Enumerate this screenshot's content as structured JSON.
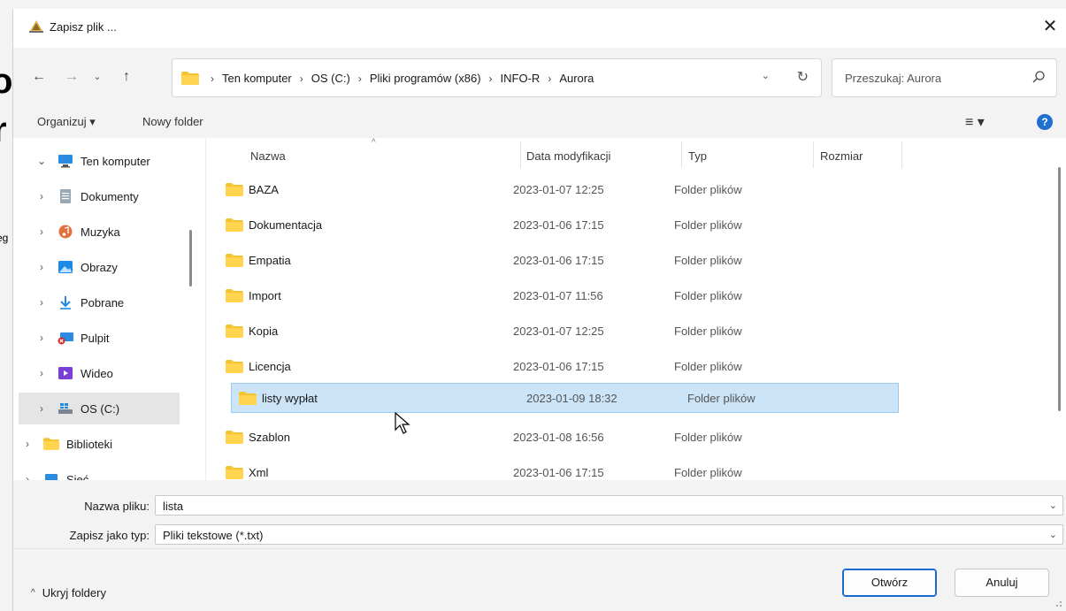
{
  "background": {
    "frag1": "o",
    "frag2": "r",
    "frag3": "eg"
  },
  "window": {
    "title": "Zapisz plik ...",
    "close": "✕"
  },
  "address": {
    "crumbs": [
      "Ten komputer",
      "OS (C:)",
      "Pliki programów (x86)",
      "INFO-R",
      "Aurora"
    ],
    "separator": "›"
  },
  "search": {
    "placeholder": "Przeszukaj: Aurora"
  },
  "toolbar": {
    "organize": "Organizuj ▾",
    "new_folder": "Nowy folder",
    "view": "≡ ▾",
    "help": "?"
  },
  "nav": {
    "items": [
      {
        "label": "Ten komputer",
        "chevron": "⌄",
        "icon": "computer-icon"
      },
      {
        "label": "Dokumenty",
        "chevron": "›",
        "icon": "documents-icon"
      },
      {
        "label": "Muzyka",
        "chevron": "›",
        "icon": "music-icon"
      },
      {
        "label": "Obrazy",
        "chevron": "›",
        "icon": "pictures-icon"
      },
      {
        "label": "Pobrane",
        "chevron": "›",
        "icon": "download-icon"
      },
      {
        "label": "Pulpit",
        "chevron": "›",
        "icon": "desktop-icon"
      },
      {
        "label": "Wideo",
        "chevron": "›",
        "icon": "video-icon"
      },
      {
        "label": "OS (C:)",
        "chevron": "›",
        "icon": "drive-icon"
      },
      {
        "label": "Biblioteki",
        "chevron": "›",
        "icon": "folder-icon"
      },
      {
        "label": "Sieć",
        "chevron": "›",
        "icon": "network-icon"
      }
    ]
  },
  "columns": {
    "name": "Nazwa",
    "date": "Data modyfikacji",
    "type": "Typ",
    "size": "Rozmiar"
  },
  "files": [
    {
      "name": "BAZA",
      "date": "2023-01-07 12:25",
      "type": "Folder plików"
    },
    {
      "name": "Dokumentacja",
      "date": "2023-01-06 17:15",
      "type": "Folder plików"
    },
    {
      "name": "Empatia",
      "date": "2023-01-06 17:15",
      "type": "Folder plików"
    },
    {
      "name": "Import",
      "date": "2023-01-07 11:56",
      "type": "Folder plików"
    },
    {
      "name": "Kopia",
      "date": "2023-01-07 12:25",
      "type": "Folder plików"
    },
    {
      "name": "Licencja",
      "date": "2023-01-06 17:15",
      "type": "Folder plików"
    },
    {
      "name": "listy wypłat",
      "date": "2023-01-09 18:32",
      "type": "Folder plików"
    },
    {
      "name": "Szablon",
      "date": "2023-01-08 16:56",
      "type": "Folder plików"
    },
    {
      "name": "Xml",
      "date": "2023-01-06 17:15",
      "type": "Folder plików"
    }
  ],
  "selected_file": "listy wypłat",
  "fields": {
    "filename_label": "Nazwa pliku:",
    "filename_value": "lista",
    "filetype_label": "Zapisz jako typ:",
    "filetype_value": "Pliki tekstowe (*.txt)"
  },
  "footer": {
    "hide_folders": "Ukryj foldery",
    "open": "Otwórz",
    "cancel": "Anuluj"
  },
  "colors": {
    "accent": "#1a6bd0",
    "selection": "#cce4f7",
    "folder": "#f4c430"
  }
}
